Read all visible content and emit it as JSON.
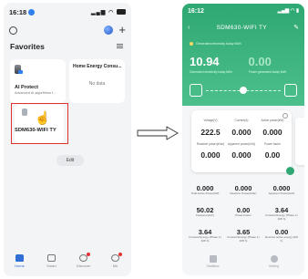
{
  "left": {
    "status": {
      "time": "16:18"
    },
    "favorites_title": "Favorites",
    "cards": [
      {
        "title": "AI Protect",
        "subtitle": "Advanced AI algorithms f..."
      },
      {
        "title": "Home Energy Consu...",
        "subtitle": "No data"
      },
      {
        "title": "SDM630-WIFI TY"
      }
    ],
    "edit_label": "Edit",
    "tabs": [
      "Home",
      "Smart",
      "Discover",
      "Me"
    ]
  },
  "right": {
    "status": {
      "time": "16:12"
    },
    "title": "SDM630-WIFI TY",
    "legend": "Generated electricity today  kWh",
    "big_values": [
      "10.94",
      "0.00"
    ],
    "big_captions": [
      "Generated electricity today kWh",
      "Power generated today kWh"
    ],
    "detail": [
      {
        "label": "Voltage(V)",
        "value": "222.5"
      },
      {
        "label": "Current(A)",
        "value": "0.000"
      },
      {
        "label": "Active power(kW)",
        "value": "0.000"
      },
      {
        "label": "Reactive power(kVar)",
        "value": "0.000"
      },
      {
        "label": "Apparent power(kVA)",
        "value": "0.000"
      },
      {
        "label": "Power factor",
        "value": "0.00"
      }
    ],
    "stats": [
      {
        "label": "Total Active Power(kW)",
        "value": "0.000"
      },
      {
        "label": "Reactive Power(kVar)",
        "value": "0.000"
      },
      {
        "label": "Apparent Power(kVA)",
        "value": "0.000"
      },
      {
        "label": "Frequency(Hz)",
        "value": "50.02"
      },
      {
        "label": "Power Factor",
        "value": "0.00"
      },
      {
        "label": "Forward Energy (Phase 1)(kW h)",
        "value": "3.64"
      },
      {
        "label": "Forward Energy (Phase 1)(kW h)",
        "value": "3.64"
      },
      {
        "label": "Forward Energy (Phase 1)(kW h)",
        "value": "3.65"
      },
      {
        "label": "Reverse active energy (kW h)",
        "value": "0.00"
      }
    ],
    "tabs": [
      "Statistics",
      "Setting"
    ]
  },
  "colors": {
    "accent_green": "#2fa873",
    "selection_red": "#e0312f",
    "tab_active_blue": "#2f6fd6"
  }
}
